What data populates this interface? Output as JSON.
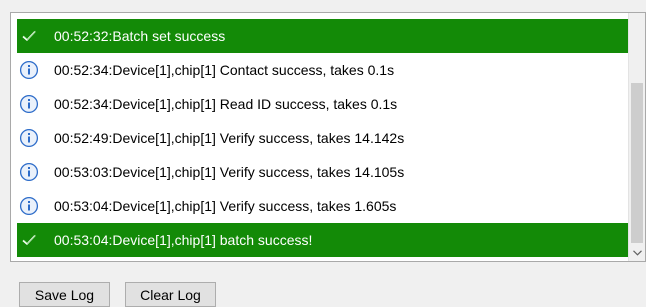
{
  "log": {
    "entries": [
      {
        "type": "success",
        "icon": "check-icon",
        "text": "00:52:32:Batch set success"
      },
      {
        "type": "info",
        "icon": "info-icon",
        "text": "00:52:34:Device[1],chip[1] Contact success, takes 0.1s"
      },
      {
        "type": "info",
        "icon": "info-icon",
        "text": "00:52:34:Device[1],chip[1] Read ID success, takes 0.1s"
      },
      {
        "type": "info",
        "icon": "info-icon",
        "text": "00:52:49:Device[1],chip[1] Verify success, takes 14.142s"
      },
      {
        "type": "info",
        "icon": "info-icon",
        "text": "00:53:03:Device[1],chip[1] Verify success, takes 14.105s"
      },
      {
        "type": "info",
        "icon": "info-icon",
        "text": "00:53:04:Device[1],chip[1] Verify success, takes 1.605s"
      },
      {
        "type": "success",
        "icon": "check-icon",
        "text": "00:53:04:Device[1],chip[1] batch success!"
      }
    ]
  },
  "buttons": {
    "save_log": "Save Log",
    "clear_log": "Clear Log"
  },
  "colors": {
    "success_bg": "#138a07",
    "info_icon": "#2d6cc9"
  }
}
